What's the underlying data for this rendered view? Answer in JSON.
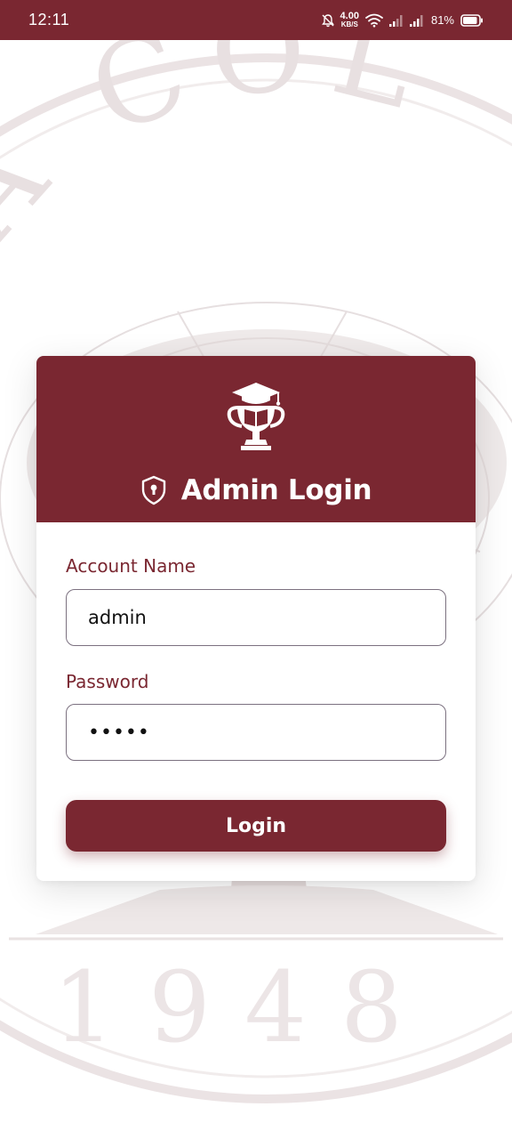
{
  "status_bar": {
    "time": "12:11",
    "net_speed_value": "4.00",
    "net_speed_unit": "KB/S",
    "battery": "81%",
    "bg_color": "#7a2731"
  },
  "background": {
    "watermark_top": "NA COL",
    "watermark_year": "1948"
  },
  "login_card": {
    "title": "Admin Login",
    "account_label": "Account Name",
    "account_value": "admin",
    "password_label": "Password",
    "password_value": "•••••",
    "login_button": "Login"
  },
  "colors": {
    "brand": "#7a2731",
    "input_border": "#7c7180"
  },
  "icons": {
    "header_icon": "trophy-graduation-icon",
    "title_icon": "shield-lock-icon"
  }
}
